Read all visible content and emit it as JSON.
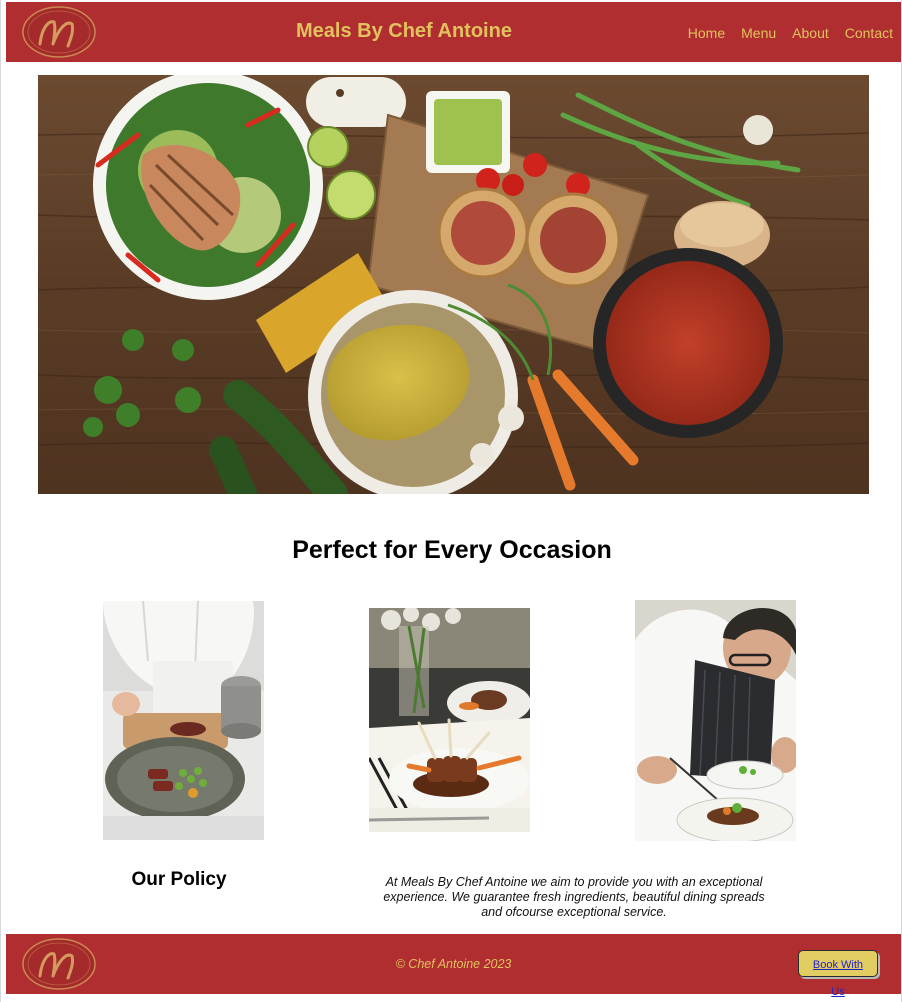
{
  "header": {
    "title": "Meals By Chef Antoine",
    "logo_letter": "M",
    "nav": [
      {
        "label": "Home"
      },
      {
        "label": "Menu"
      },
      {
        "label": "About"
      },
      {
        "label": "Contact"
      }
    ]
  },
  "main": {
    "section_title": "Perfect for Every Occasion",
    "policy_title": "Our Policy",
    "policy_text": "At Meals By Chef Antoine we aim to provide you with an exceptional experience. We guarantee fresh ingredients, beautiful dining spreads and ofcourse exceptional service."
  },
  "footer": {
    "copyright": "© Chef Antoine 2023",
    "book_button": "Book With Us",
    "logo_letter": "M"
  },
  "colors": {
    "brand_red": "#b02e2f",
    "gold": "#e2c15f",
    "button_bg": "#e2cd62"
  }
}
